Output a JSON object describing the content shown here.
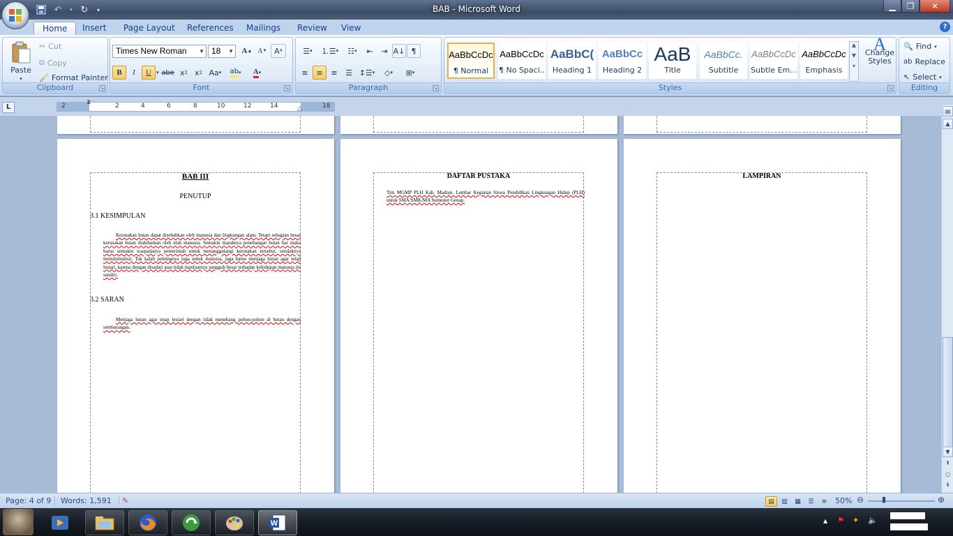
{
  "window": {
    "title": "BAB - Microsoft Word"
  },
  "tabs": [
    "Home",
    "Insert",
    "Page Layout",
    "References",
    "Mailings",
    "Review",
    "View"
  ],
  "clipboard": {
    "paste": "Paste",
    "cut": "Cut",
    "copy": "Copy",
    "format_painter": "Format Painter",
    "label": "Clipboard"
  },
  "font": {
    "family": "Times New Roman",
    "size": "18",
    "label": "Font"
  },
  "paragraph": {
    "label": "Paragraph"
  },
  "styles": {
    "label": "Styles",
    "items": [
      {
        "sample": "AaBbCcDc",
        "name": "¶ Normal"
      },
      {
        "sample": "AaBbCcDc",
        "name": "¶ No Spaci..."
      },
      {
        "sample": "AaBbC(",
        "name": "Heading 1"
      },
      {
        "sample": "AaBbCc",
        "name": "Heading 2"
      },
      {
        "sample": "AaB",
        "name": "Title"
      },
      {
        "sample": "AaBbCc.",
        "name": "Subtitle"
      },
      {
        "sample": "AaBbCcDc",
        "name": "Subtle Em..."
      },
      {
        "sample": "AaBbCcDc",
        "name": "Emphasis"
      }
    ],
    "change_styles": "Change Styles"
  },
  "editing": {
    "find": "Find",
    "replace": "Replace",
    "select": "Select",
    "label": "Editing"
  },
  "ruler": {
    "ticks": [
      "2",
      "2",
      "4",
      "6",
      "8",
      "10",
      "12",
      "14",
      "18"
    ]
  },
  "pages": {
    "page1": {
      "heading": "BAB III",
      "subheading": "PENUTUP",
      "section1": "3.1  KESIMPULAN",
      "para1": "Kerusakan hutan dapat disebabkan oleh manusia dan lingkungan alam. Tetapi sebagian besar kerusakan hutan diakibatkan oleh ulah manusia. Semakin maraknya penebangan hutan liar maka harus semakin waspadanya pemerintah untuk menanggulangi kerusakan tersebut, setidaknya meminimalisir. Tak kalah pentingnya juga untuk manusia, juga harus menjaga hutan agar tetap lestari, karena dengan disadari atau tidak manfaatnya sungguh besar terhadap kehidupan manusia itu sendiri.",
      "section2": "3.2  SARAN",
      "para2": "Menjaga hutan agar tetap lestari dengan tidak menebang pohon-pohon di hutan dengan sembarangan."
    },
    "page2": {
      "heading": "DAFTAR PUSTAKA",
      "ref1": "Tim MGMP PLH Kab. Madiun. Lembar Kegiatan Siswa Pendidikan Lingkungan Hidup (PLH) untuk SMA/SMK/MA Semester Genap."
    },
    "page3": {
      "heading": "LAMPIRAN"
    }
  },
  "status": {
    "page": "Page: 4 of 9",
    "words": "Words: 1,591",
    "zoom": "50%"
  }
}
